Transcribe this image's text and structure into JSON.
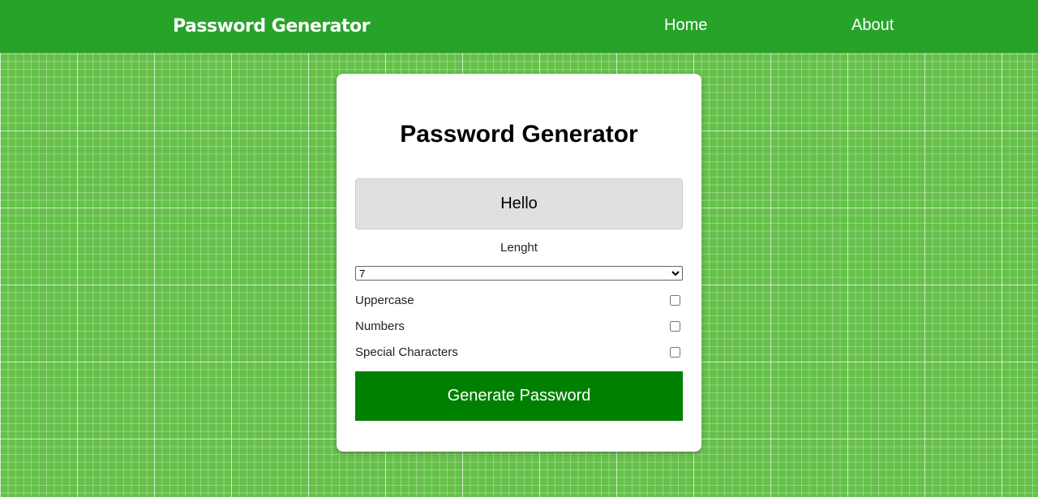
{
  "nav": {
    "brand": "Password Generator",
    "links": [
      "Home",
      "About"
    ]
  },
  "card": {
    "title": "Password Generator",
    "output": "Hello",
    "length_label": "Lenght",
    "length_value": "7",
    "options": [
      {
        "label": "Uppercase",
        "checked": false
      },
      {
        "label": "Numbers",
        "checked": false
      },
      {
        "label": "Special Characters",
        "checked": false
      }
    ],
    "generate_label": "Generate Password"
  },
  "colors": {
    "header": "#27a32a",
    "background": "#66c14a",
    "button": "#008000"
  }
}
